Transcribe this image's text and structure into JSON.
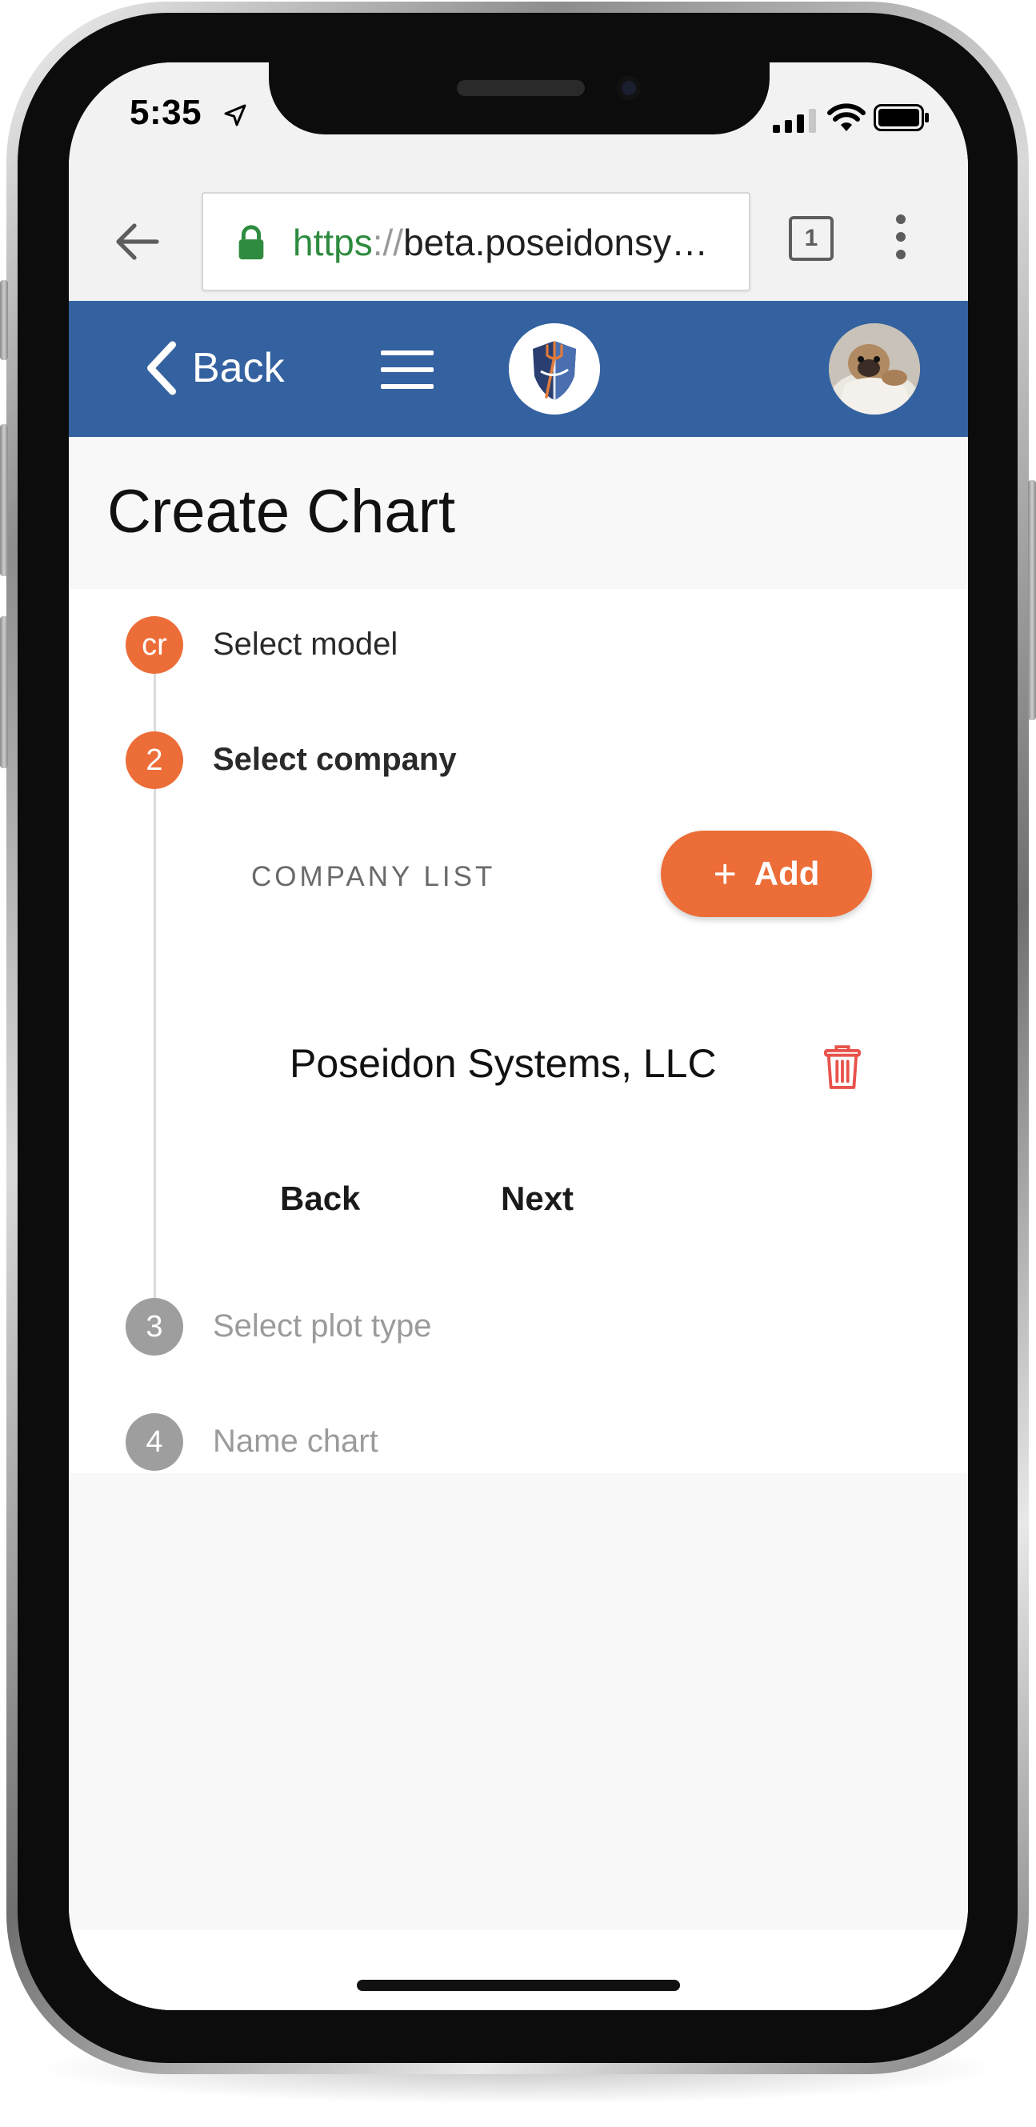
{
  "status_bar": {
    "time": "5:35"
  },
  "browser": {
    "url_scheme": "https",
    "url_separator": "://",
    "url_rest": "beta.poseidonsy…",
    "tab_count": "1"
  },
  "header": {
    "back_label": "Back"
  },
  "page": {
    "title": "Create Chart"
  },
  "stepper": {
    "steps": [
      {
        "marker": "cr",
        "label": "Select model",
        "state": "completed"
      },
      {
        "marker": "2",
        "label": "Select company",
        "state": "active"
      },
      {
        "marker": "3",
        "label": "Select plot type",
        "state": "inactive"
      },
      {
        "marker": "4",
        "label": "Name chart",
        "state": "inactive"
      }
    ],
    "company_list_label": "COMPANY LIST",
    "add_label": "Add",
    "companies": [
      "Poseidon Systems, LLC"
    ],
    "back_label": "Back",
    "next_label": "Next"
  },
  "colors": {
    "header_blue": "#3462a0",
    "accent_orange": "#ec6d38",
    "delete_red": "#e8534b",
    "url_green": "#2e8b3f",
    "inactive_grey": "#9e9e9e"
  },
  "icons": {
    "location": "location-arrow-icon",
    "signal": "cellular-signal-icon",
    "wifi": "wifi-icon",
    "battery": "battery-icon",
    "back_arrow": "arrow-left-icon",
    "lock": "lock-icon",
    "tabs": "tabs-icon",
    "more": "more-vertical-icon",
    "back_chevron": "chevron-left-icon",
    "menu": "hamburger-menu-icon",
    "plus": "plus-icon",
    "delete": "trash-icon"
  }
}
